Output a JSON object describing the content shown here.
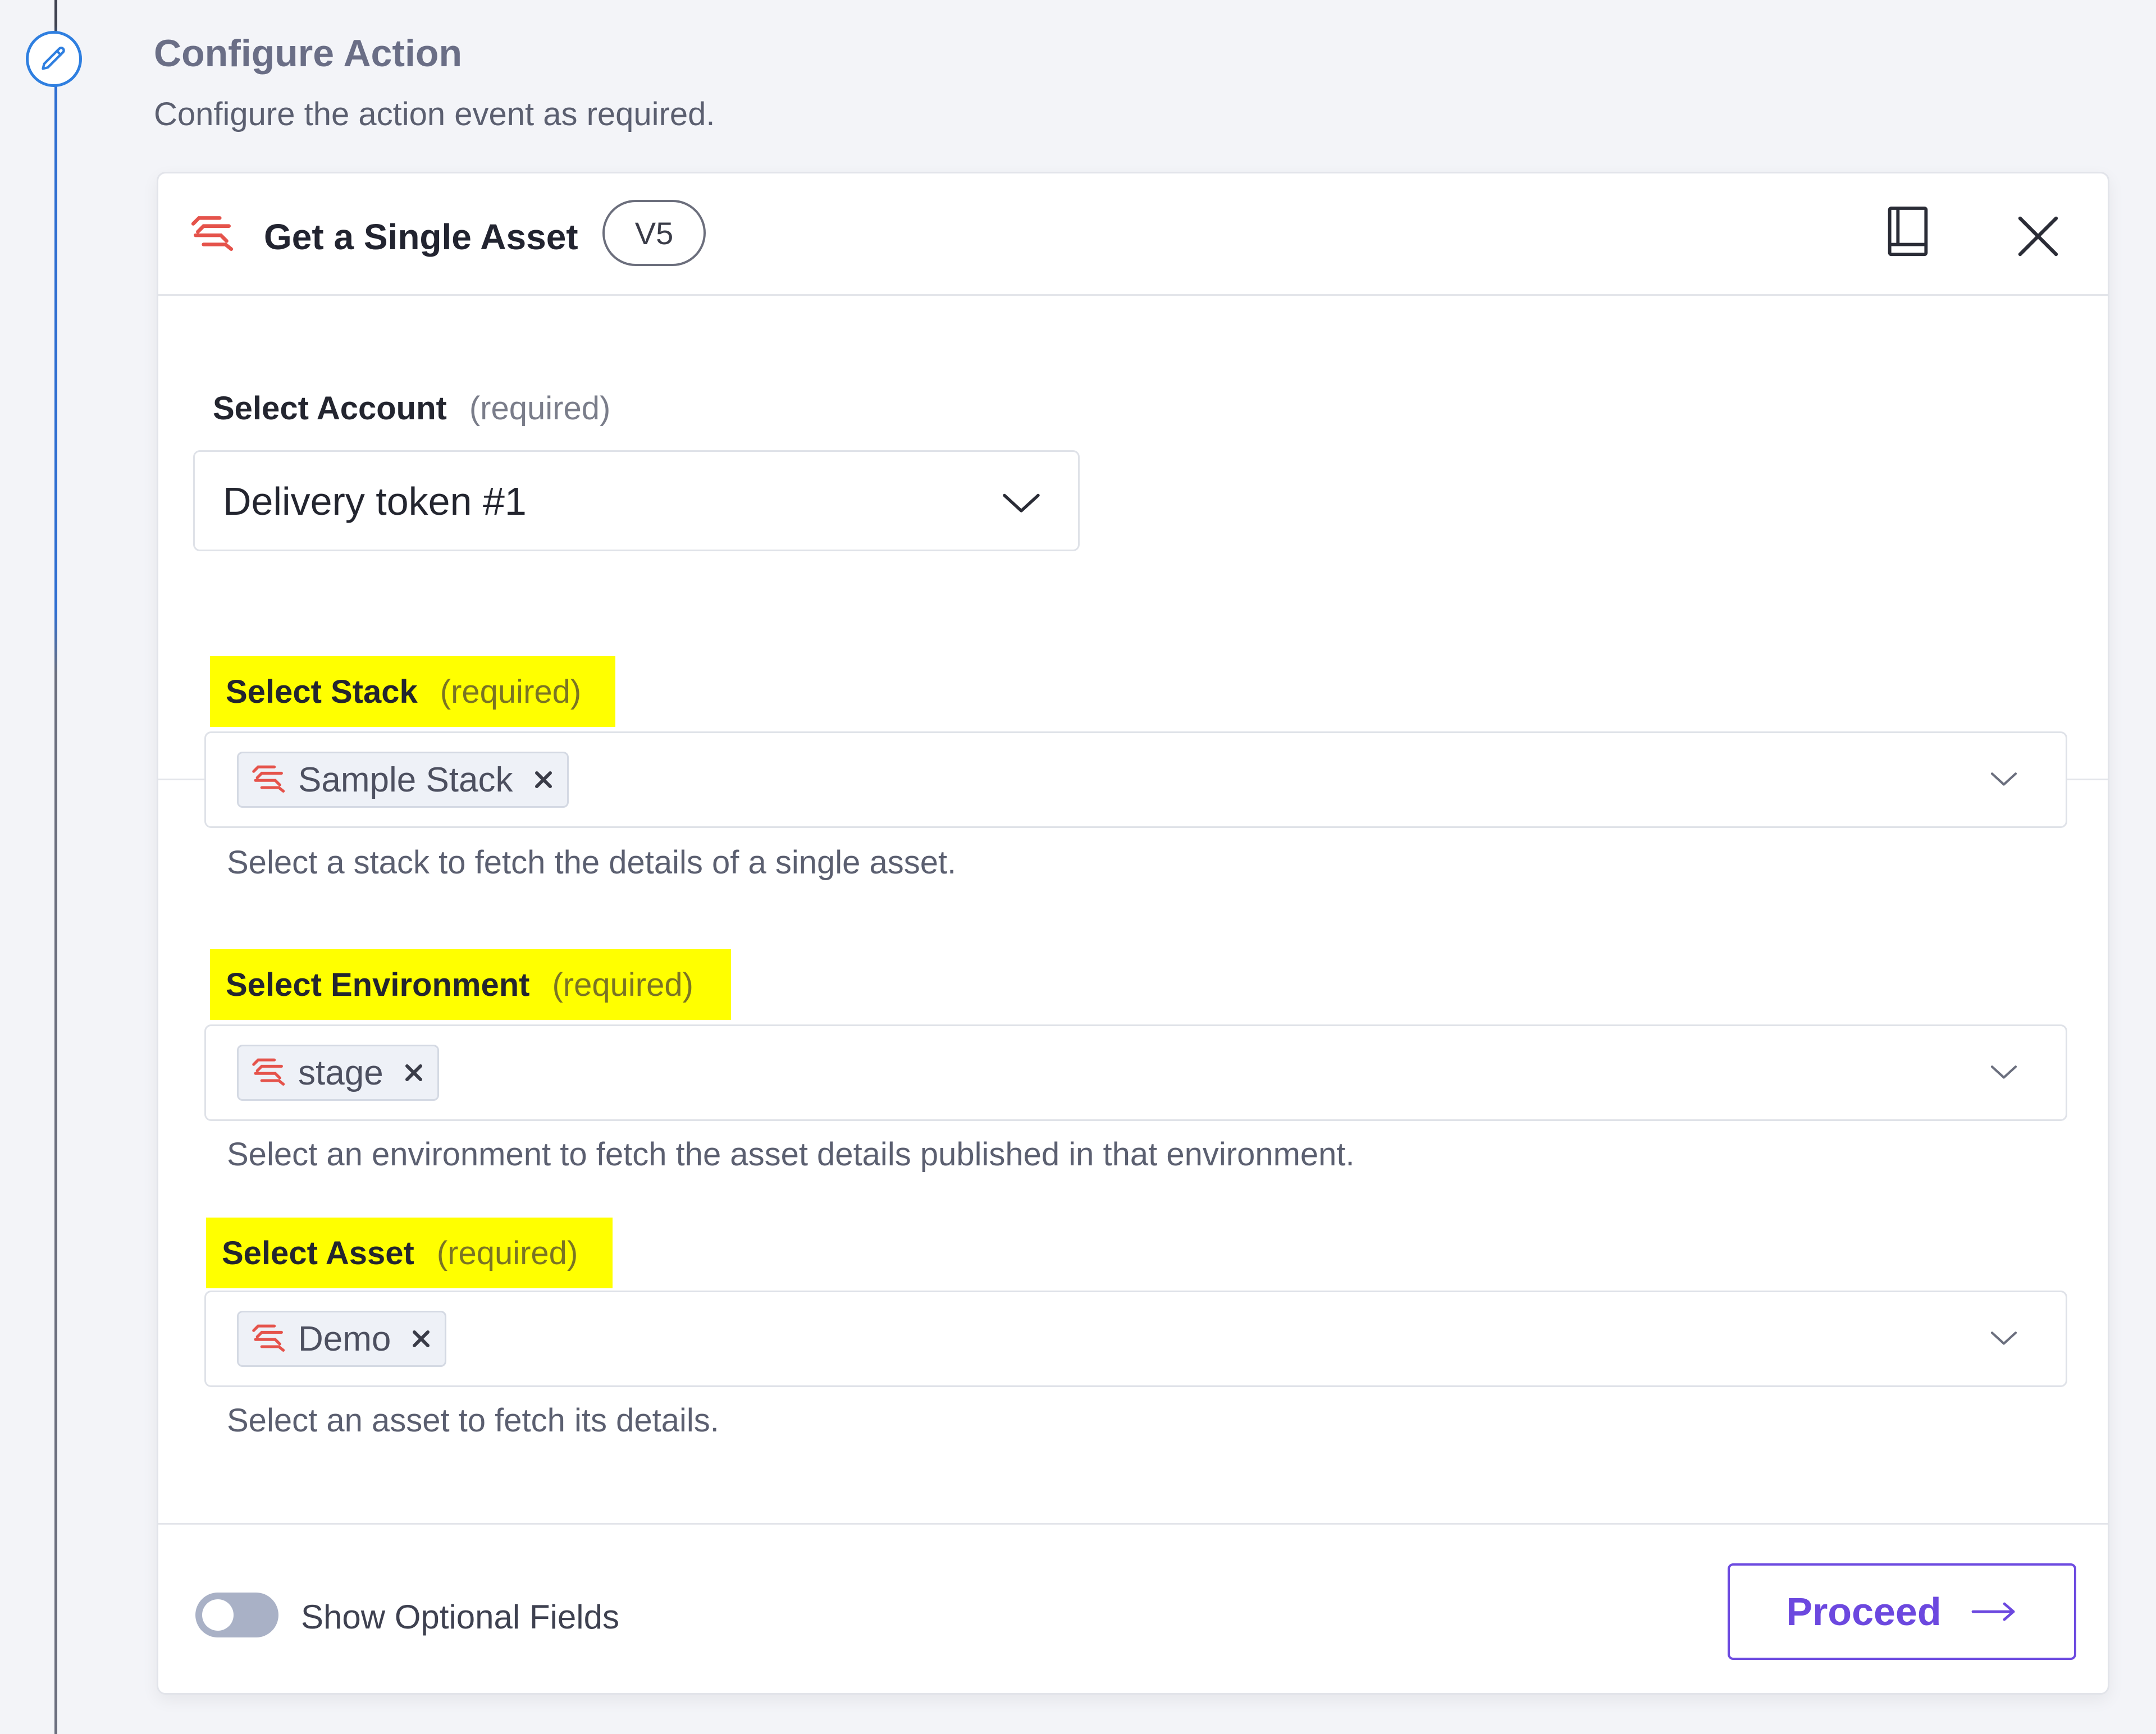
{
  "page": {
    "title": "Configure Action",
    "subtitle": "Configure the action event as required."
  },
  "card": {
    "title": "Get a Single Asset",
    "version": "V5"
  },
  "account": {
    "label": "Select Account",
    "required": "(required)",
    "value": "Delivery token #1"
  },
  "stack": {
    "label": "Select Stack",
    "required": "(required)",
    "chip": "Sample Stack",
    "help": "Select a stack to fetch the details of a single asset."
  },
  "environment": {
    "label": "Select Environment",
    "required": "(required)",
    "chip": "stage",
    "help": "Select an environment to fetch the asset details published in that environment."
  },
  "asset": {
    "label": "Select Asset",
    "required": "(required)",
    "chip": "Demo",
    "help": "Select an asset to fetch its details."
  },
  "footer": {
    "toggle_label": "Show Optional Fields",
    "toggle_on": false,
    "proceed_label": "Proceed"
  },
  "colors": {
    "highlight": "#ffff00",
    "accent": "#6c48df",
    "timeline": "#2f6ed1",
    "brand": "#e5534b"
  },
  "icons": {
    "step": "pencil-icon",
    "brand": "contentstack-logo-icon",
    "docs": "book-icon",
    "close": "close-icon",
    "dropdown": "chevron-down-icon",
    "remove": "x-icon",
    "proceed": "arrow-right-icon"
  }
}
